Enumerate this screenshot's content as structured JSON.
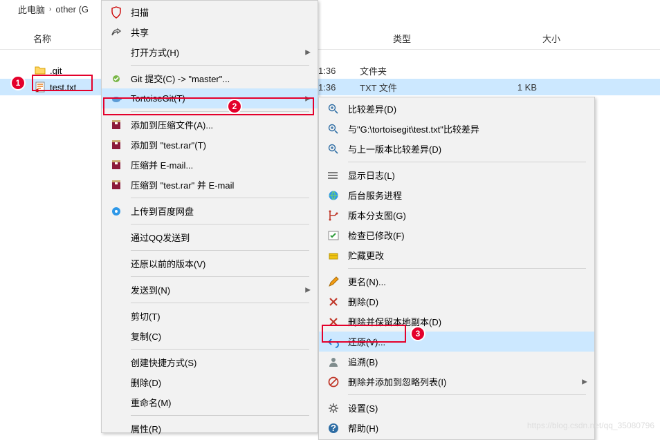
{
  "breadcrumb": {
    "root": "此电脑",
    "drive": "other (G"
  },
  "columns": {
    "name": "名称",
    "type": "类型",
    "size": "大小"
  },
  "files": [
    {
      "name": ".git",
      "date": "1:36",
      "type": "文件夹",
      "size": ""
    },
    {
      "name": "test.txt",
      "date": "1:36",
      "type": "TXT 文件",
      "size": "1 KB"
    }
  ],
  "menu1": [
    {
      "icon": "shield",
      "label": "扫描"
    },
    {
      "icon": "share",
      "label": "共享"
    },
    {
      "label": "打开方式(H)",
      "arrow": true
    },
    {
      "sep": true
    },
    {
      "icon": "commit",
      "label": "Git 提交(C) -> \"master\"..."
    },
    {
      "icon": "tortoise",
      "label": "TortoiseGit(T)",
      "arrow": true,
      "hl": true,
      "red": true
    },
    {
      "sep": true
    },
    {
      "icon": "rar",
      "label": "添加到压缩文件(A)..."
    },
    {
      "icon": "rar",
      "label": "添加到 \"test.rar\"(T)"
    },
    {
      "icon": "rar",
      "label": "压缩并 E-mail..."
    },
    {
      "icon": "rar",
      "label": "压缩到 \"test.rar\" 并 E-mail"
    },
    {
      "sep": true
    },
    {
      "icon": "disk",
      "label": "上传到百度网盘"
    },
    {
      "sep": true
    },
    {
      "label": "通过QQ发送到"
    },
    {
      "sep": true
    },
    {
      "label": "还原以前的版本(V)"
    },
    {
      "sep": true
    },
    {
      "label": "发送到(N)",
      "arrow": true
    },
    {
      "sep": true
    },
    {
      "label": "剪切(T)"
    },
    {
      "label": "复制(C)"
    },
    {
      "sep": true
    },
    {
      "label": "创建快捷方式(S)"
    },
    {
      "label": "删除(D)"
    },
    {
      "label": "重命名(M)"
    },
    {
      "sep": true
    },
    {
      "label": "属性(R)"
    }
  ],
  "menu2": [
    {
      "icon": "mag-plus",
      "label": "比较差异(D)"
    },
    {
      "icon": "mag-plus",
      "label": "与\"G:\\tortoisegit\\test.txt\"比较差异"
    },
    {
      "icon": "mag-plus",
      "label": "与上一版本比较差异(D)"
    },
    {
      "sep": true
    },
    {
      "icon": "log",
      "label": "显示日志(L)"
    },
    {
      "icon": "globe",
      "label": "后台服务进程"
    },
    {
      "icon": "branch",
      "label": "版本分支图(G)"
    },
    {
      "icon": "check",
      "label": "检查已修改(F)"
    },
    {
      "icon": "stash",
      "label": "贮藏更改"
    },
    {
      "sep": true
    },
    {
      "icon": "pen",
      "label": "更名(N)..."
    },
    {
      "icon": "x",
      "label": "删除(D)"
    },
    {
      "icon": "x",
      "label": "删除并保留本地副本(D)"
    },
    {
      "icon": "undo",
      "label": "还原(V)...",
      "hl": true,
      "red": true
    },
    {
      "icon": "blame",
      "label": "追溯(B)"
    },
    {
      "icon": "ignore",
      "label": "删除并添加到忽略列表(I)",
      "arrow": true
    },
    {
      "sep": true
    },
    {
      "icon": "gear",
      "label": "设置(S)"
    },
    {
      "icon": "help",
      "label": "帮助(H)"
    }
  ],
  "badges": {
    "1": "1",
    "2": "2",
    "3": "3"
  },
  "watermark": "https://blog.csdn.net/qq_35080796"
}
